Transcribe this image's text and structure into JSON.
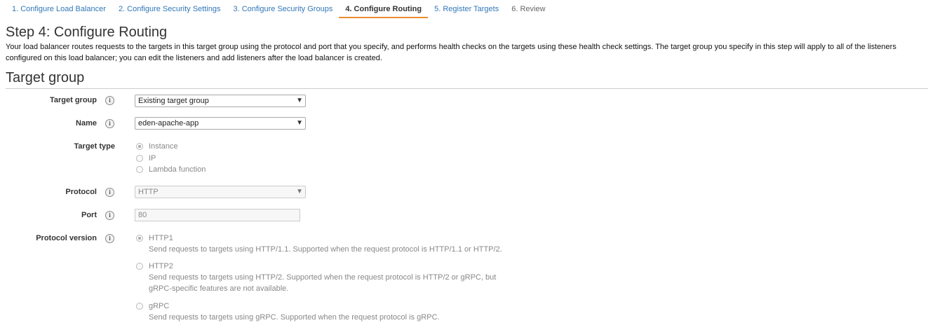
{
  "wizard": {
    "tabs": [
      {
        "label": "1. Configure Load Balancer"
      },
      {
        "label": "2. Configure Security Settings"
      },
      {
        "label": "3. Configure Security Groups"
      },
      {
        "label": "4. Configure Routing"
      },
      {
        "label": "5. Register Targets"
      },
      {
        "label": "6. Review"
      }
    ],
    "active_tab": "4. Configure Routing"
  },
  "page": {
    "title": "Step 4: Configure Routing",
    "intro": "Your load balancer routes requests to the targets in this target group using the protocol and port that you specify, and performs health checks on the targets using these health check settings. The target group you specify in this step will apply to all of the listeners configured on this load balancer; you can edit the listeners and add listeners after the load balancer is created."
  },
  "target_group_section": {
    "title": "Target group",
    "target_group": {
      "label": "Target group",
      "value": "Existing target group"
    },
    "name": {
      "label": "Name",
      "value": "eden-apache-app"
    },
    "target_type": {
      "label": "Target type",
      "options": [
        {
          "label": "Instance",
          "selected": true
        },
        {
          "label": "IP",
          "selected": false
        },
        {
          "label": "Lambda function",
          "selected": false
        }
      ]
    },
    "protocol": {
      "label": "Protocol",
      "value": "HTTP"
    },
    "port": {
      "label": "Port",
      "value": "80"
    },
    "protocol_version": {
      "label": "Protocol version",
      "options": [
        {
          "label": "HTTP1",
          "selected": true,
          "description": "Send requests to targets using HTTP/1.1. Supported when the request protocol is HTTP/1.1 or HTTP/2."
        },
        {
          "label": "HTTP2",
          "selected": false,
          "description_line1": "Send requests to targets using HTTP/2. Supported when the request protocol is HTTP/2 or gRPC, but",
          "description_line2": "gRPC-specific features are not available."
        },
        {
          "label": "gRPC",
          "selected": false,
          "description": "Send requests to targets using gRPC. Supported when the request protocol is gRPC."
        }
      ]
    }
  },
  "icons": {
    "info": "info-icon",
    "select_caret": "chevron-down-icon"
  },
  "colors": {
    "link": "#3277b8",
    "active_tab_underline": "#eb8c2f"
  }
}
